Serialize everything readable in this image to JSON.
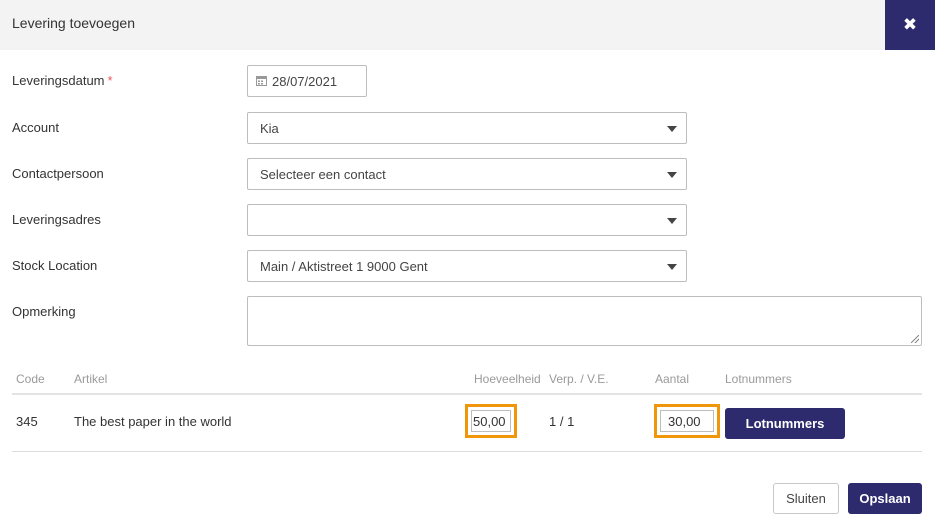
{
  "dialog": {
    "title": "Levering toevoegen",
    "close_glyph": "✖"
  },
  "form": {
    "delivery_date": {
      "label": "Leveringsdatum",
      "required_mark": "*",
      "value": "28/07/2021"
    },
    "account": {
      "label": "Account",
      "value": "Kia"
    },
    "contact": {
      "label": "Contactpersoon",
      "value": "Selecteer een contact"
    },
    "address": {
      "label": "Leveringsadres",
      "value": ""
    },
    "stock_location": {
      "label": "Stock Location",
      "value": "Main / Aktistreet 1 9000 Gent"
    },
    "remark": {
      "label": "Opmerking",
      "value": ""
    }
  },
  "table": {
    "columns": [
      "Code",
      "Artikel",
      "Hoeveelheid",
      "Verp. / V.E.",
      "Aantal",
      "Lotnummers"
    ],
    "rows": [
      {
        "code": "345",
        "article": "The best paper in the world",
        "quantity": "50,00",
        "packaging": "1 / 1",
        "amount": "30,00",
        "lot_button": "Lotnummers"
      }
    ]
  },
  "footer": {
    "close_label": "Sluiten",
    "save_label": "Opslaan"
  },
  "colors": {
    "primary": "#2e2a6e",
    "highlight": "#f0960a",
    "required": "#e85b5b"
  }
}
